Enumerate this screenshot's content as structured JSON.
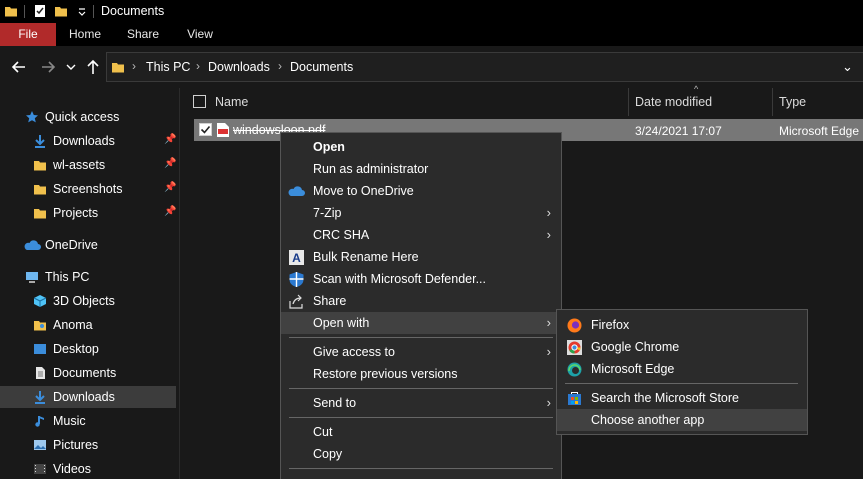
{
  "window": {
    "title": "Documents"
  },
  "ribbon": {
    "tabs": [
      "File",
      "Home",
      "Share",
      "View"
    ]
  },
  "address": {
    "crumbs": [
      "This PC",
      "Downloads",
      "Documents"
    ]
  },
  "sidebar": {
    "items": [
      {
        "label": "Quick access",
        "icon": "star-icon",
        "pinned": false
      },
      {
        "label": "Downloads",
        "icon": "download-arrow-icon",
        "pinned": true
      },
      {
        "label": "wl-assets",
        "icon": "folder-icon",
        "pinned": true
      },
      {
        "label": "Screenshots",
        "icon": "folder-icon",
        "pinned": true
      },
      {
        "label": "Projects",
        "icon": "folder-icon",
        "pinned": true
      },
      {
        "label": "OneDrive",
        "icon": "cloud-icon",
        "pinned": false
      },
      {
        "label": "This PC",
        "icon": "computer-icon",
        "pinned": false
      },
      {
        "label": "3D Objects",
        "icon": "cube-icon",
        "pinned": false
      },
      {
        "label": "Anoma",
        "icon": "user-folder-icon",
        "pinned": false
      },
      {
        "label": "Desktop",
        "icon": "desktop-icon",
        "pinned": false
      },
      {
        "label": "Documents",
        "icon": "document-icon",
        "pinned": false
      },
      {
        "label": "Downloads",
        "icon": "download-arrow-icon",
        "pinned": false,
        "selected": true
      },
      {
        "label": "Music",
        "icon": "music-note-icon",
        "pinned": false
      },
      {
        "label": "Pictures",
        "icon": "pictures-icon",
        "pinned": false
      },
      {
        "label": "Videos",
        "icon": "video-icon",
        "pinned": false
      }
    ]
  },
  "columns": {
    "name": "Name",
    "date": "Date modified",
    "type": "Type"
  },
  "file": {
    "name": "windowsloon.pdf",
    "date": "3/24/2021 17:07",
    "type": "Microsoft Edge"
  },
  "context_menu": {
    "items": [
      {
        "label": "Open",
        "bold": true
      },
      {
        "label": "Run as administrator"
      },
      {
        "label": "Move to OneDrive",
        "icon": "onedrive-icon"
      },
      {
        "label": "7-Zip",
        "submenu": true
      },
      {
        "label": "CRC SHA",
        "submenu": true
      },
      {
        "label": "Bulk Rename Here",
        "icon": "bulk-rename-icon"
      },
      {
        "label": "Scan with Microsoft Defender...",
        "icon": "defender-shield-icon"
      },
      {
        "label": "Share",
        "icon": "share-icon"
      },
      {
        "label": "Open with",
        "submenu": true,
        "highlighted": true
      },
      {
        "label": "Give access to",
        "submenu": true
      },
      {
        "label": "Restore previous versions"
      },
      {
        "label": "Send to",
        "submenu": true
      },
      {
        "label": "Cut"
      },
      {
        "label": "Copy"
      }
    ]
  },
  "open_with_menu": {
    "items": [
      {
        "label": "Firefox",
        "icon": "firefox-icon"
      },
      {
        "label": "Google Chrome",
        "icon": "chrome-icon"
      },
      {
        "label": "Microsoft Edge",
        "icon": "edge-icon"
      },
      {
        "label": "Search the Microsoft Store",
        "icon": "store-icon"
      },
      {
        "label": "Choose another app",
        "highlighted": true
      }
    ]
  },
  "colors": {
    "file_tab": "#b12a2a",
    "selection": "#777777",
    "menu_bg": "#2b2b2b",
    "folder": "#f0c04c",
    "accent_blue": "#3b8ddb"
  }
}
